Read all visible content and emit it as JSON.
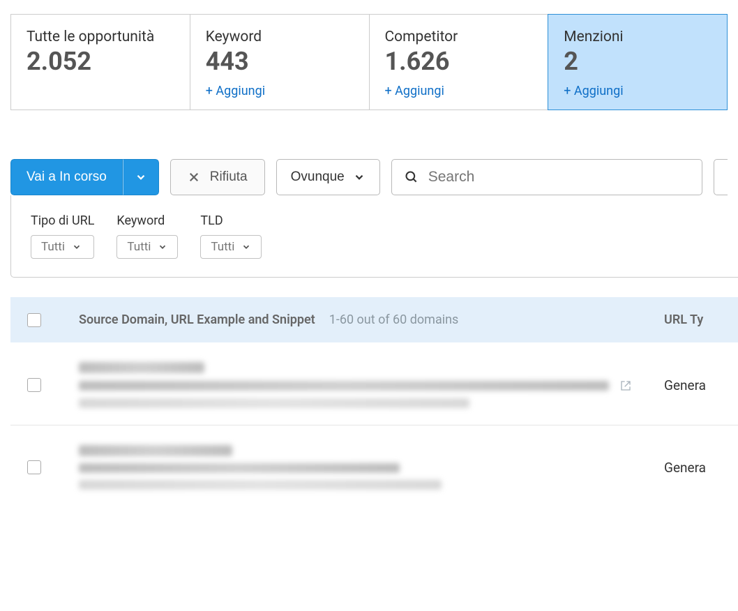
{
  "tabs": {
    "all": {
      "label": "Tutte le opportunità",
      "value": "2.052"
    },
    "keyword": {
      "label": "Keyword",
      "value": "443",
      "add": "+ Aggiungi"
    },
    "competitor": {
      "label": "Competitor",
      "value": "1.626",
      "add": "+ Aggiungi"
    },
    "mentions": {
      "label": "Menzioni",
      "value": "2",
      "add": "+ Aggiungi"
    }
  },
  "toolbar": {
    "go_in_progress": "Vai a In corso",
    "reject": "Rifiuta",
    "anywhere": "Ovunque",
    "search_placeholder": "Search"
  },
  "filters": {
    "url_type_label": "Tipo di URL",
    "keyword_label": "Keyword",
    "tld_label": "TLD",
    "all": "Tutti"
  },
  "table": {
    "col_source": "Source Domain, URL Example and Snippet",
    "col_range": "1-60 out of 60 domains",
    "col_url_type": "URL Ty",
    "rows": [
      {
        "url_type": "Genera"
      },
      {
        "url_type": "Genera"
      }
    ]
  }
}
